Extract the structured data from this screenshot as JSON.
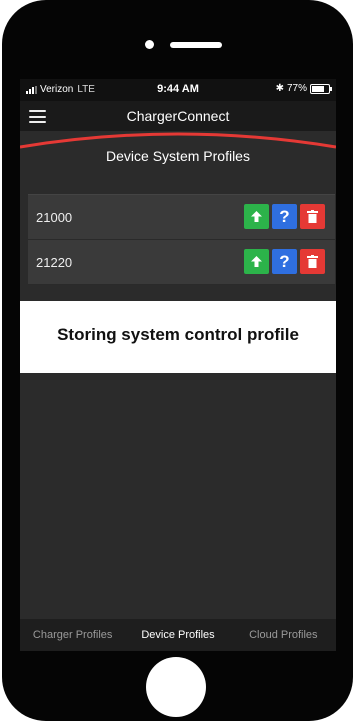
{
  "status_bar": {
    "carrier": "Verizon",
    "network": "LTE",
    "time": "9:44 AM",
    "bluetooth_icon": "bluetooth-icon",
    "battery_percent": "77%",
    "battery_level": 0.77
  },
  "app_bar": {
    "menu_icon": "hamburger-menu-icon",
    "title": "ChargerConnect"
  },
  "section": {
    "title": "Device System Profiles"
  },
  "profiles": [
    {
      "name": "21000"
    },
    {
      "name": "21220"
    }
  ],
  "row_actions": {
    "load_icon": "upload-arrow-icon",
    "help_label": "?",
    "delete_icon": "trash-icon"
  },
  "overlay": {
    "message": "Storing system control profile"
  },
  "tabs": [
    {
      "label": "Charger Profiles",
      "active": false
    },
    {
      "label": "Device Profiles",
      "active": true
    },
    {
      "label": "Cloud Profiles",
      "active": false
    }
  ],
  "colors": {
    "accent_red": "#e53935",
    "load_green": "#2cb34a",
    "help_blue": "#2f6fe0"
  }
}
